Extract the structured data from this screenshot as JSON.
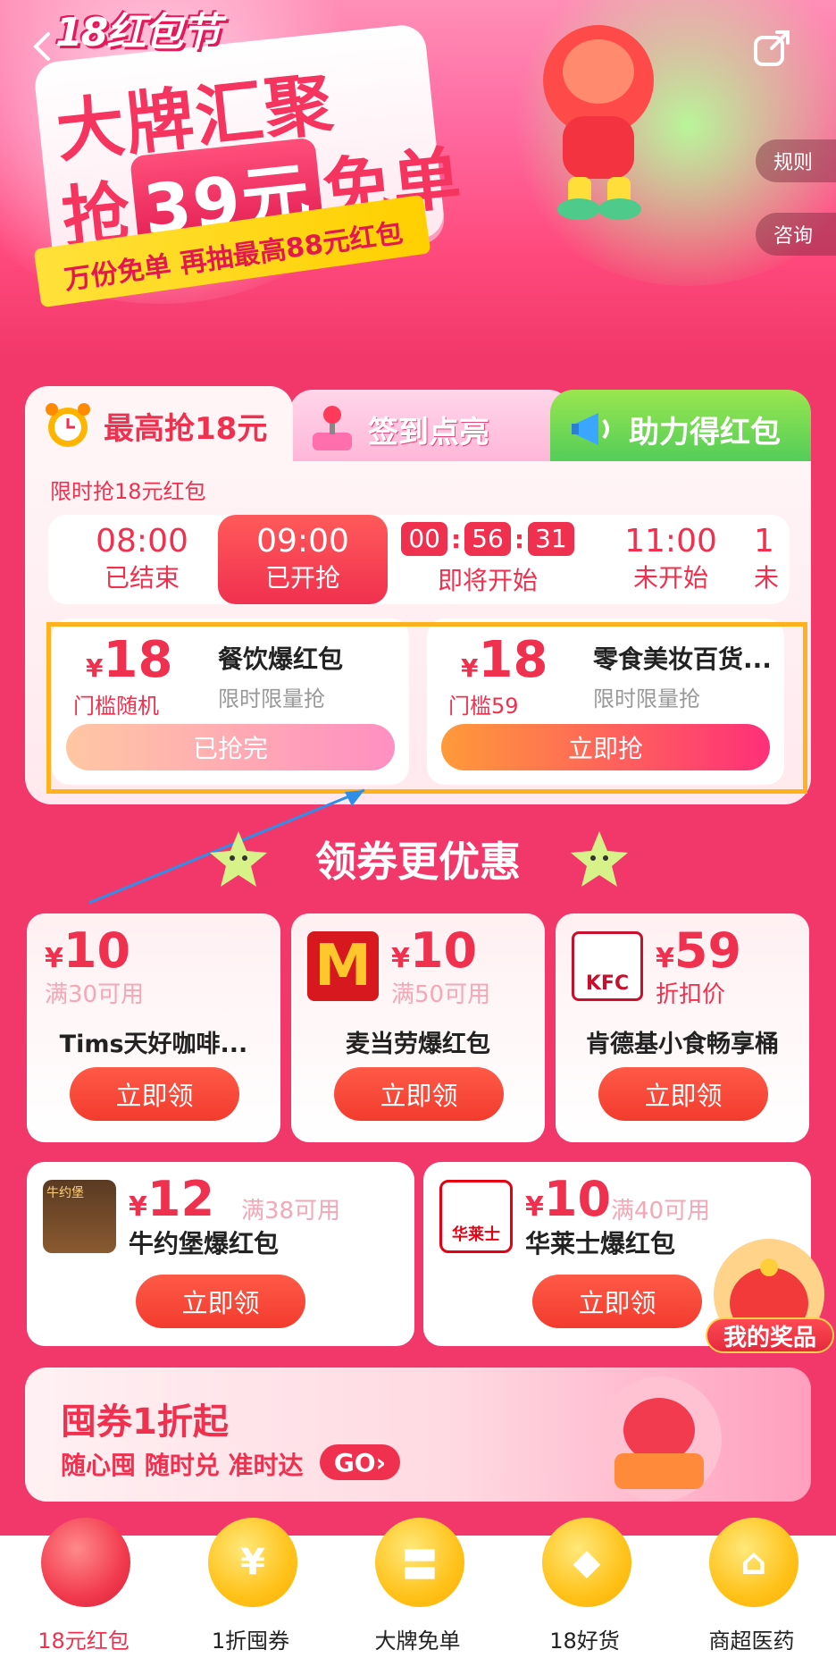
{
  "hero": {
    "festival": "18红包节",
    "headline_line1": "大牌汇聚",
    "headline_pre": "抢",
    "headline_highlight": "39元",
    "headline_post": "免单",
    "subline": "万份免单 再抽最高88元红包",
    "rules_label": "规则",
    "consult_label": "咨询"
  },
  "tabs": [
    {
      "label": "最高抢18元",
      "icon": "alarm-clock-icon"
    },
    {
      "label": "签到点亮",
      "icon": "joystick-icon"
    },
    {
      "label": "助力得红包",
      "icon": "megaphone-icon"
    }
  ],
  "panel": {
    "title": "限时抢18元红包",
    "slots": [
      {
        "time": "08:00",
        "status": "已结束"
      },
      {
        "time": "09:00",
        "status": "已开抢"
      },
      {
        "countdown": [
          "00",
          "56",
          "31"
        ],
        "status": "即将开始"
      },
      {
        "time": "11:00",
        "status": "未开始"
      },
      {
        "time": "1",
        "status": "未"
      }
    ],
    "cards": [
      {
        "currency": "¥",
        "amount": "18",
        "condition": "门槛随机",
        "name": "餐饮爆红包",
        "tag": "限时限量抢",
        "button": "已抢完"
      },
      {
        "currency": "¥",
        "amount": "18",
        "condition": "门槛59",
        "name": "零食美妆百货...",
        "tag": "限时限量抢",
        "button": "立即抢"
      }
    ]
  },
  "section": {
    "title": "领券更优惠",
    "row1": [
      {
        "currency": "¥",
        "amount": "10",
        "condition": "满30可用",
        "name": "Tims天好咖啡...",
        "button": "立即领",
        "logo": ""
      },
      {
        "currency": "¥",
        "amount": "10",
        "condition": "满50可用",
        "name": "麦当劳爆红包",
        "button": "立即领",
        "logo": "M"
      },
      {
        "currency": "¥",
        "amount": "59",
        "condition": "折扣价",
        "name": "肯德基小食畅享桶",
        "button": "立即领",
        "logo": "KFC"
      }
    ],
    "row2": [
      {
        "currency": "¥",
        "amount": "12",
        "condition": "满38可用",
        "name": "牛约堡爆红包",
        "button": "立即领",
        "logo": "牛约堡"
      },
      {
        "currency": "¥",
        "amount": "10",
        "condition": "满40可用",
        "name": "华莱士爆红包",
        "button": "立即领",
        "logo": "华莱士"
      }
    ],
    "prize_label": "我的奖品"
  },
  "promo": {
    "title": "囤券1折起",
    "subtitle": "随心囤 随时兑 准时达",
    "go": "GO"
  },
  "nav": [
    {
      "label": "18元红包",
      "glyph": "",
      "active": true
    },
    {
      "label": "1折囤券",
      "glyph": "¥",
      "active": false
    },
    {
      "label": "大牌免单",
      "glyph": "〓",
      "active": false
    },
    {
      "label": "18好货",
      "glyph": "◆",
      "active": false
    },
    {
      "label": "商超医药",
      "glyph": "⌂",
      "active": false
    }
  ],
  "colors": {
    "primary": "#f0304f",
    "page_bg": "#f2386a",
    "highlight_border": "#ffb21e"
  }
}
